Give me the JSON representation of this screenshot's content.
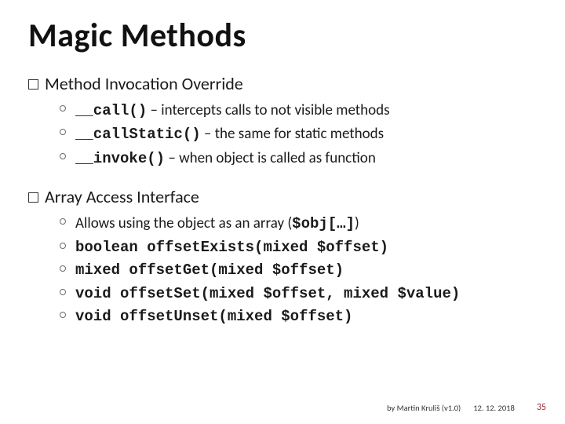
{
  "title": "Magic Methods",
  "sections": [
    {
      "label_pre": "Method",
      "label_post": " Invocation Override",
      "items": [
        {
          "code": "__call()",
          "desc": " – intercepts calls to not visible methods"
        },
        {
          "code": "__callStatic()",
          "desc": " – the same for static methods"
        },
        {
          "code": "__invoke()",
          "desc": " – when object is called as function"
        }
      ]
    },
    {
      "label_pre": "Array",
      "label_post": " Access Interface",
      "items": [
        {
          "text_pre": "Allows using the object as an array (",
          "code": "$obj[…]",
          "text_post": ")"
        },
        {
          "full_code": "boolean offsetExists(mixed $offset)"
        },
        {
          "full_code": "mixed offsetGet(mixed $offset)"
        },
        {
          "full_code": "void offsetSet(mixed $offset, mixed $value)"
        },
        {
          "full_code": "void offsetUnset(mixed $offset)"
        }
      ]
    }
  ],
  "footer": {
    "author": "by Martin Kruliš (v1.0)",
    "date": "12. 12. 2018",
    "page": "35"
  }
}
